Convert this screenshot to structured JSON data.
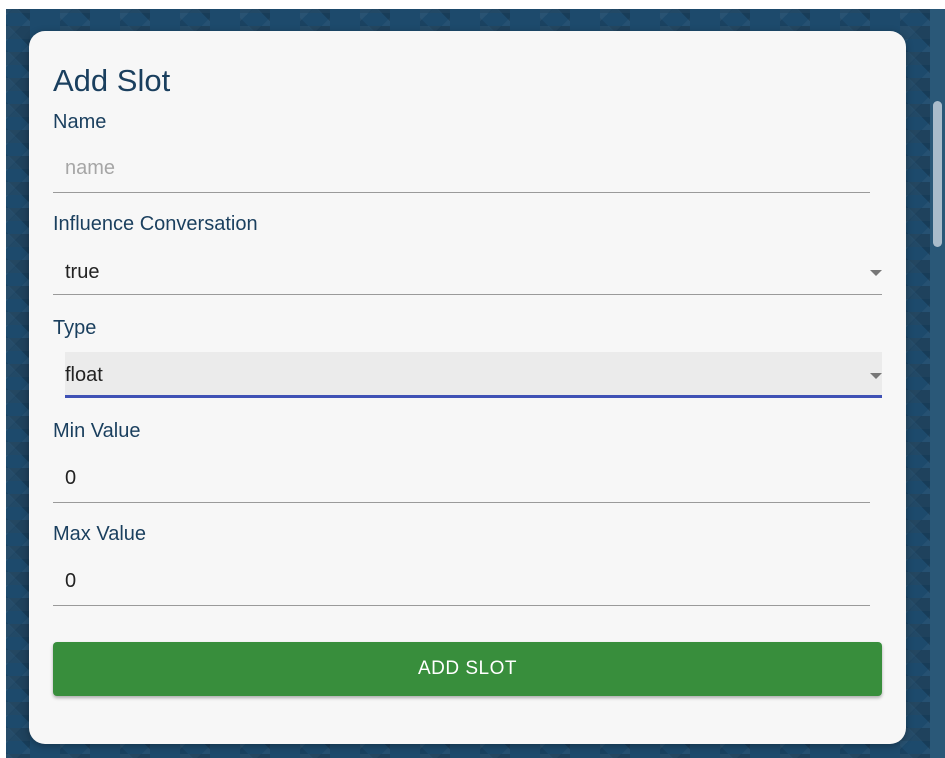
{
  "form": {
    "title": "Add Slot",
    "name": {
      "label": "Name",
      "value": "",
      "placeholder": "name"
    },
    "influence": {
      "label": "Influence Conversation",
      "value": "true"
    },
    "type": {
      "label": "Type",
      "value": "float"
    },
    "min_value": {
      "label": "Min Value",
      "value": "0"
    },
    "max_value": {
      "label": "Max Value",
      "value": "0"
    },
    "submit_label": "ADD SLOT"
  },
  "colors": {
    "background": "#1d4a6c",
    "card": "#f7f7f7",
    "heading": "#1a3f5e",
    "focus_underline": "#3f51b5",
    "submit_button": "#388e3c"
  },
  "icons": {
    "select_caret": "chevron-down-icon"
  }
}
